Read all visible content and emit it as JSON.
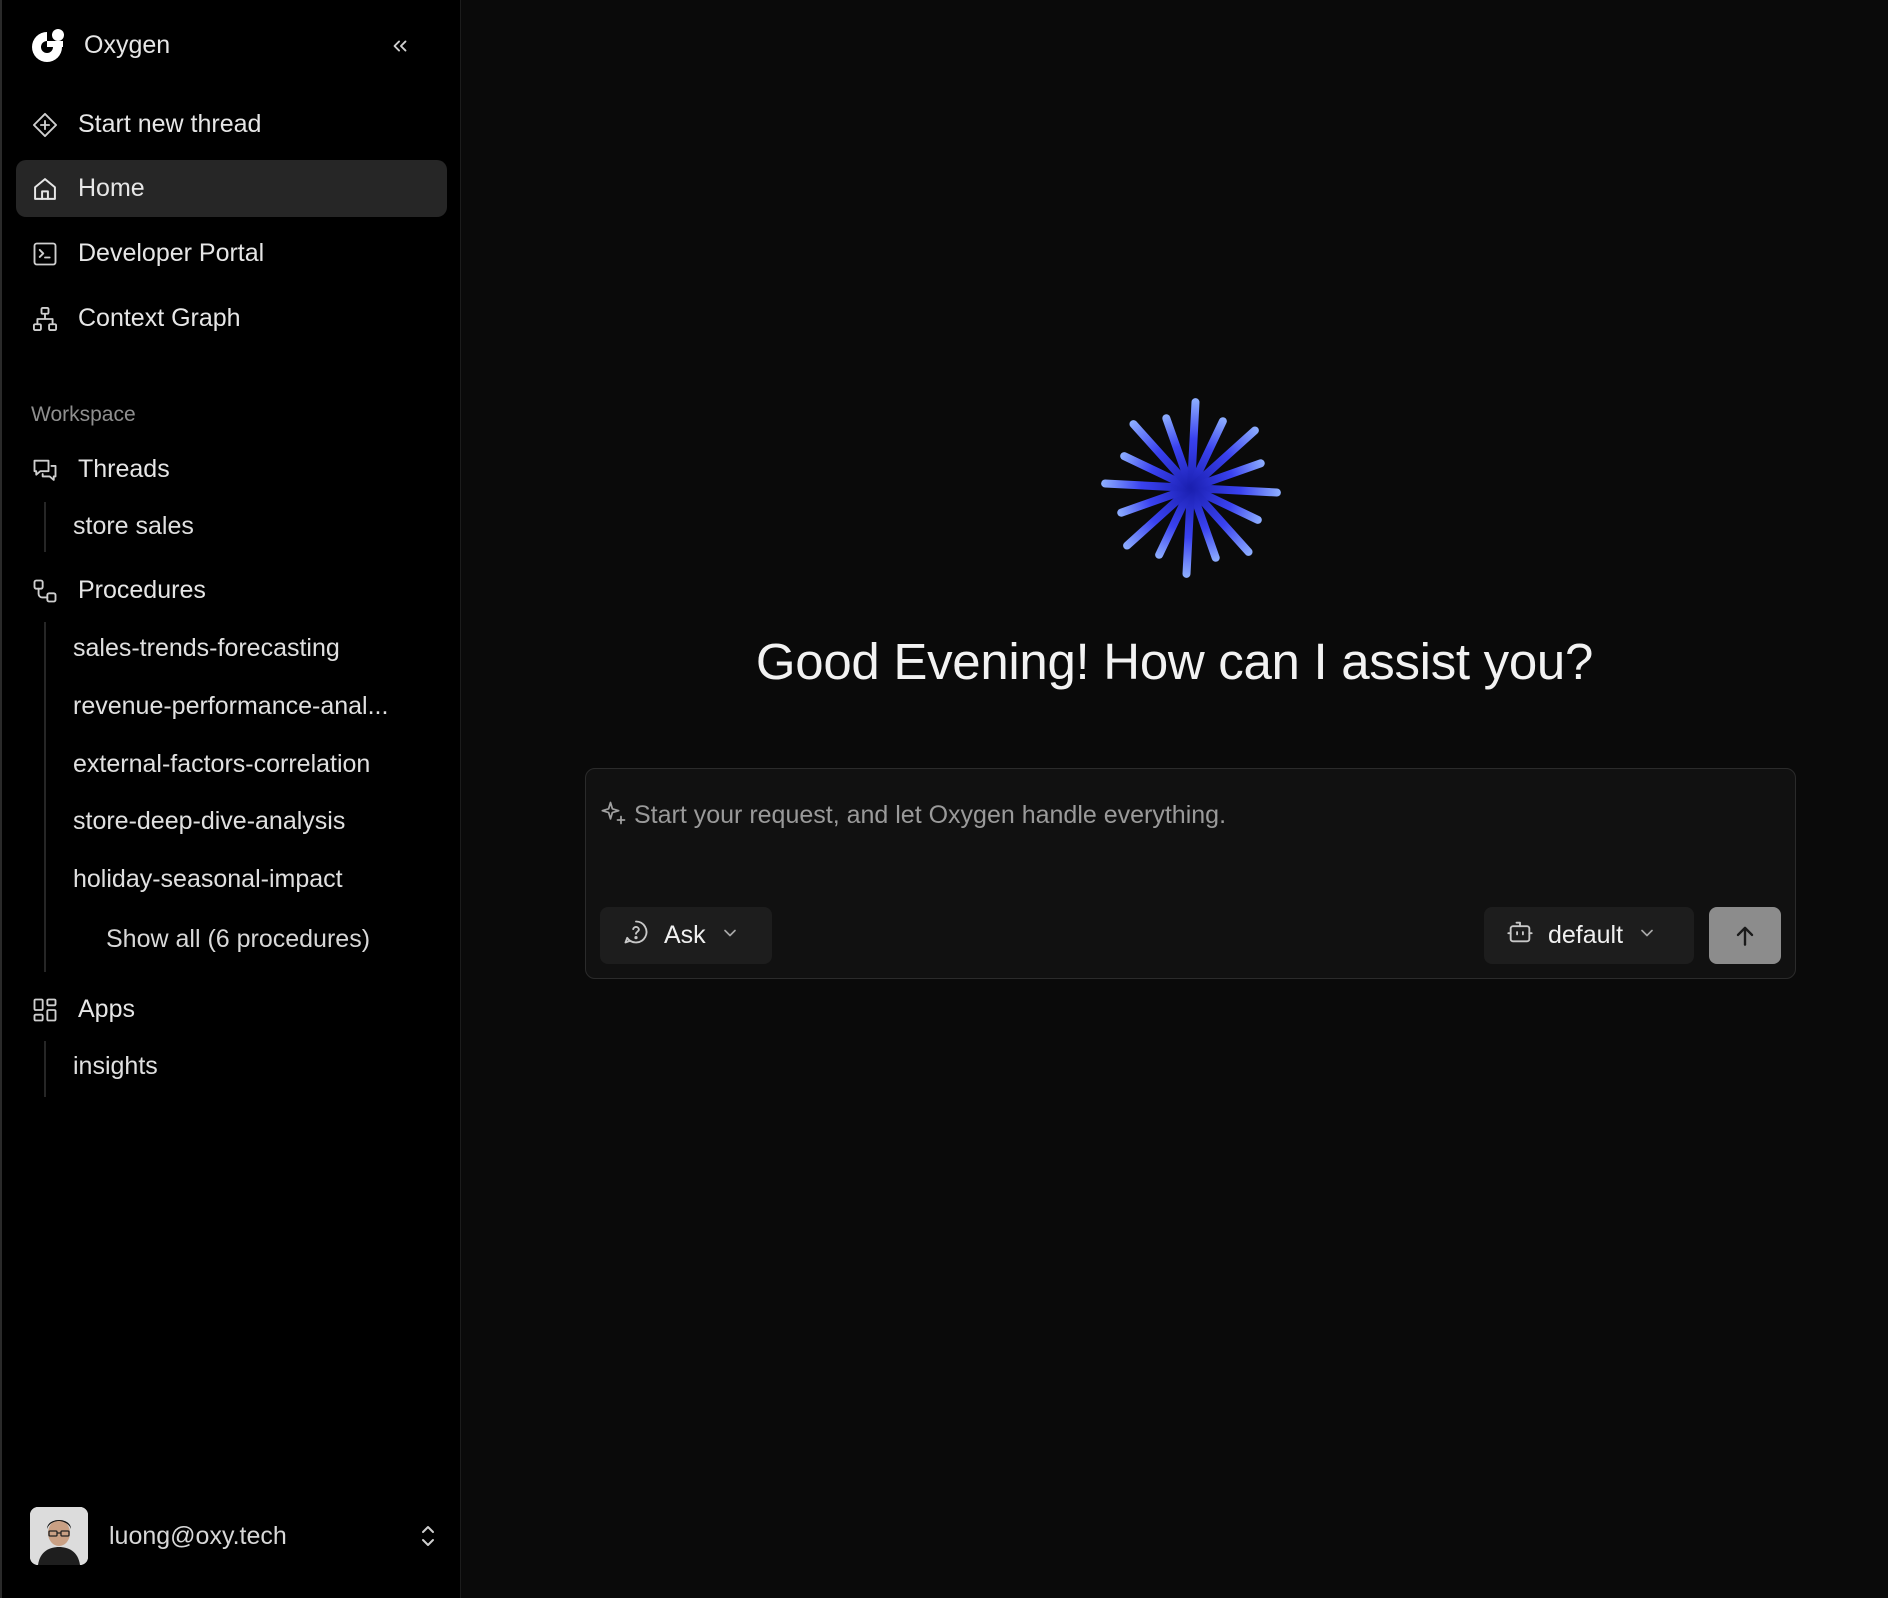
{
  "app": {
    "name": "Oxygen"
  },
  "sidebar": {
    "nav": [
      {
        "label": "Start new thread",
        "icon": "diamond-plus-icon"
      },
      {
        "label": "Home",
        "icon": "home-icon",
        "active": true
      },
      {
        "label": "Developer Portal",
        "icon": "terminal-icon"
      },
      {
        "label": "Context Graph",
        "icon": "network-icon"
      }
    ],
    "workspace_label": "Workspace",
    "threads": {
      "label": "Threads",
      "icon": "chat-bubbles-icon",
      "items": [
        "store sales"
      ]
    },
    "procedures": {
      "label": "Procedures",
      "icon": "workflow-icon",
      "items": [
        "sales-trends-forecasting",
        "revenue-performance-anal...",
        "external-factors-correlation",
        "store-deep-dive-analysis",
        "holiday-seasonal-impact"
      ],
      "show_all": "Show all (6 procedures)"
    },
    "apps": {
      "label": "Apps",
      "icon": "grid-icon",
      "items": [
        "insights"
      ]
    },
    "user": {
      "email": "luong@oxy.tech"
    }
  },
  "main": {
    "greeting": "Good Evening! How can I assist you?",
    "composer": {
      "placeholder": "Start your request, and let Oxygen handle everything.",
      "value": "",
      "mode": "Ask",
      "agent": "default"
    }
  },
  "colors": {
    "sidebar_bg": "#000000",
    "main_bg": "#0a0a0a",
    "active_item_bg": "#262626",
    "accent_starburst": "#3a3ee8",
    "send_button": "#8c8c8c"
  }
}
